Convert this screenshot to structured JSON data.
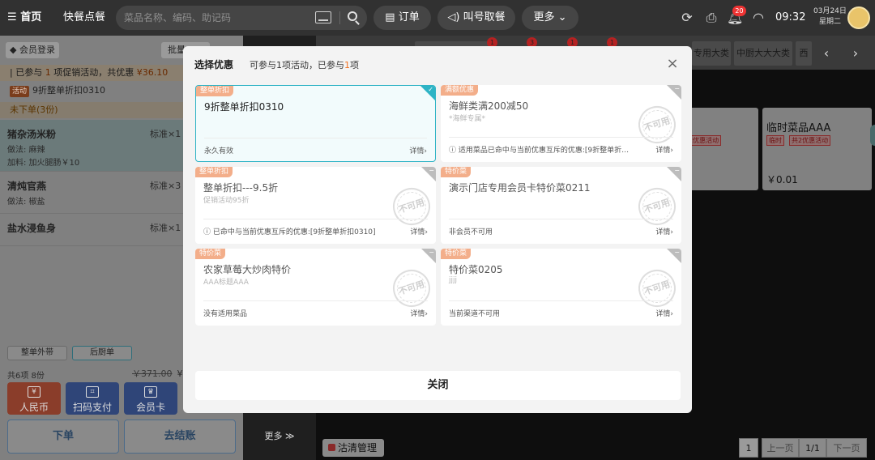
{
  "topbar": {
    "home": "首页",
    "fast_order": "快餐点餐",
    "search_placeholder": "菜品名称、编码、助记码",
    "order_btn": "订单",
    "call_btn": "叫号取餐",
    "more_btn": "更多",
    "notification_count": "20",
    "time": "09:32",
    "date": "03月24日",
    "weekday": "星期二"
  },
  "left": {
    "member_login": "会员登录",
    "batch_btn": "批量",
    "promo_prefix": "已参与",
    "promo_count": "1",
    "promo_mid": "项促销活动，共优惠",
    "promo_amount": "¥36.10",
    "activity_tag": "活动",
    "activity_name": "9折整单折扣0310",
    "unordered": "未下单(3份)",
    "dishes": [
      {
        "name": "猪杂汤米粉",
        "qty": "标准×1",
        "line1": "做法:   麻辣",
        "line2": "加料:   加火腿肠￥10"
      },
      {
        "name": "清炖官燕",
        "qty": "标准×3",
        "line1": "做法:   椒盐"
      },
      {
        "name": "盐水浸鱼身",
        "qty": "标准×1"
      }
    ],
    "tab_takeout": "整单外带",
    "tab_kitchen": "后厨单",
    "summary": "共6项 8份",
    "orig_price": "￥371.00",
    "price": "¥",
    "pay_cash": "人民币",
    "pay_scan": "扫码支付",
    "pay_card": "会员卡",
    "place_order": "下单",
    "checkout": "去结账"
  },
  "middle": {
    "more": "更多 ≫"
  },
  "right": {
    "badges": [
      "1",
      "3",
      "1",
      "1"
    ],
    "cat_a": "专用大类",
    "cat_b": "中厨大大大类",
    "cat_c": "西",
    "card_a_tag": "2优惠活动",
    "card_b_name": "临时菜品AAA",
    "card_b_tag1": "临时",
    "card_b_tag2": "共2优惠活动",
    "card_b_price": "￥0.01",
    "clear_btn": "沽清管理",
    "page_current": "1",
    "prev_page": "上一页",
    "page_info": "1/1",
    "next_page": "下一页"
  },
  "modal": {
    "title": "选择优惠",
    "sub_pre": "可参与1项活动，已参与",
    "sub_num": "1",
    "sub_post": "项",
    "close_label": "关闭",
    "details": "详情",
    "stamp": "不可用",
    "coupons": [
      {
        "tag": "整单折扣",
        "name": "9折整单折扣0310",
        "desc": "",
        "footer": "永久有效",
        "selected": true
      },
      {
        "tag": "满额优惠",
        "name": "海鲜类满200减50",
        "desc": "*海鲜专属*",
        "footer": "ⓘ 适用菜品已命中与当前优惠互斥的优惠:[9折整单折扣0310]",
        "selected": false
      },
      {
        "tag": "整单折扣",
        "name": "整单折扣---9.5折",
        "desc": "促销活动95折",
        "footer": "ⓘ 已命中与当前优惠互斥的优惠:[9折整单折扣0310]",
        "selected": false
      },
      {
        "tag": "特价菜",
        "name": "演示门店专用会员卡特价菜0211",
        "desc": "",
        "footer": "非会员不可用",
        "selected": false
      },
      {
        "tag": "特价菜",
        "name": "农家草莓大炒肉特价",
        "desc": "AAA标题AAA",
        "footer": "没有适用菜品",
        "selected": false
      },
      {
        "tag": "特价菜",
        "name": "特价菜0205",
        "desc": "jjjj",
        "footer": "当前渠道不可用",
        "selected": false
      }
    ]
  },
  "colors": {
    "accent": "#2eb3c5",
    "tag": "#f3ae8a",
    "highlight": "#f07020"
  }
}
